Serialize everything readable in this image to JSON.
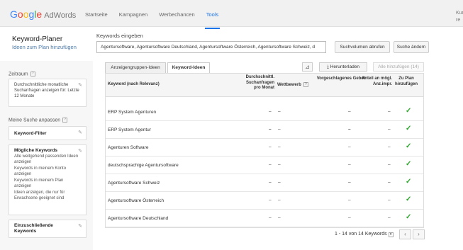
{
  "app": {
    "logo_google": "Google",
    "logo_product": "AdWords"
  },
  "nav": {
    "items": [
      {
        "label": "Startseite"
      },
      {
        "label": "Kampagnen"
      },
      {
        "label": "Werbechancen"
      },
      {
        "label": "Tools"
      }
    ],
    "active": "Tools",
    "account_fragment": "Kun re"
  },
  "page": {
    "title": "Keyword-Planer",
    "subtitle": "Ideen zum Plan hinzufügen"
  },
  "keywords": {
    "label": "Keywords eingeben",
    "value": "Agentursoftware, Agentursoftware Deutschland, Agentursoftware Österreich, Agentursoftware Schweiz, d",
    "volume_button": "Suchvolumen abrufen",
    "change_button": "Suche ändern"
  },
  "sidebar": {
    "period_label": "Zeitraum",
    "period_text": "Durchschnittliche monatliche Suchanfragen anzeigen für: Letzte 12 Monate",
    "customize_label": "Meine Suche anpassen",
    "keyword_filter": "Keyword-Filter",
    "possible_title": "Mögliche Keywords",
    "possible_items": [
      "Alle weitgehend passenden Ideen anzeigen",
      "Keywords in meinem Konto anzeigen",
      "Keywords in meinem Plan anzeigen",
      "Ideen anzeigen, die nur für Erwachsene geeignet sind"
    ],
    "include_title": "Einzuschließende Keywords"
  },
  "tabs": {
    "adgroup": "Anzeigengruppen-Ideen",
    "keywords": "Keyword-Ideen",
    "download": "Herunterladen",
    "add_all": "Alle hinzufügen (14)"
  },
  "table": {
    "headers": {
      "keyword": "Keyword (nach Relevanz)",
      "search": "Durchschnittl. Suchanfragen pro Monat",
      "competition": "Wettbewerb",
      "bid": "Vorgeschlagenes Gebot",
      "share": "Anteil an mögl. Anz.impr.",
      "add": "Zu Plan hinzufügen"
    },
    "rows": [
      {
        "keyword": "ERP System Agenturen",
        "search": "–",
        "competition": "–",
        "bid": "–",
        "share": "–"
      },
      {
        "keyword": "ERP System Agentur",
        "search": "–",
        "competition": "–",
        "bid": "–",
        "share": "–"
      },
      {
        "keyword": "Agenturen Software",
        "search": "–",
        "competition": "–",
        "bid": "–",
        "share": "–"
      },
      {
        "keyword": "deutschsprachige Agentursoftware",
        "search": "–",
        "competition": "–",
        "bid": "–",
        "share": "–"
      },
      {
        "keyword": "Agentursoftware Schweiz",
        "search": "–",
        "competition": "–",
        "bid": "–",
        "share": "–"
      },
      {
        "keyword": "Agentursoftware Österreich",
        "search": "–",
        "competition": "–",
        "bid": "–",
        "share": "–"
      },
      {
        "keyword": "Agentursoftware Deutschland",
        "search": "–",
        "competition": "–",
        "bid": "–",
        "share": "–"
      }
    ]
  },
  "pager": {
    "range": "1 - 14",
    "of_label": "von",
    "total": "14",
    "unit": "Keywords"
  },
  "icons": {
    "check": "check-icon",
    "pencil": "pencil-icon",
    "help": "help-icon",
    "chart": "chart-icon",
    "download": "download-icon"
  },
  "colors": {
    "accent": "#1a73e8",
    "check": "#2aa62a",
    "link": "#4a78a8"
  }
}
